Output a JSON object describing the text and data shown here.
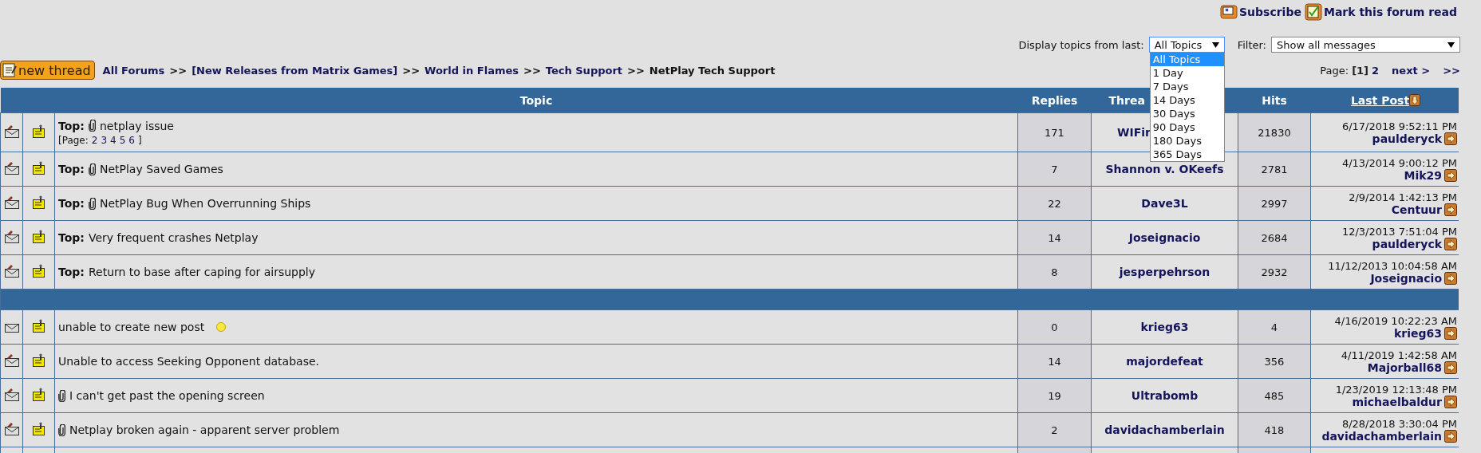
{
  "header_links": [
    {
      "label": "Subscribe",
      "kind": "subscribe"
    },
    {
      "label": "Mark this forum read",
      "kind": "mark_read"
    }
  ],
  "display_filter": {
    "label": "Display topics from last:",
    "value": "All Topics",
    "expanded": true,
    "options": [
      {
        "label": "All Topics",
        "selected": true
      },
      {
        "label": "1 Day",
        "selected": false
      },
      {
        "label": "7 Days",
        "selected": false
      },
      {
        "label": "14 Days",
        "selected": false
      },
      {
        "label": "30 Days",
        "selected": false
      },
      {
        "label": "90 Days",
        "selected": false
      },
      {
        "label": "180 Days",
        "selected": false
      },
      {
        "label": "365 Days",
        "selected": false
      }
    ]
  },
  "message_filter": {
    "label": "Filter:",
    "value": "Show all messages"
  },
  "new_thread_button": {
    "label": "new thread"
  },
  "breadcrumb": [
    {
      "label": "All Forums",
      "kind": "link"
    },
    {
      "label": ">>",
      "kind": "separator"
    },
    {
      "label": "[New Releases from Matrix Games]",
      "kind": "link"
    },
    {
      "label": ">>",
      "kind": "separator"
    },
    {
      "label": "World in Flames",
      "kind": "link"
    },
    {
      "label": ">>",
      "kind": "separator"
    },
    {
      "label": "Tech Support",
      "kind": "link"
    },
    {
      "label": ">>",
      "kind": "separator"
    },
    {
      "label": "NetPlay Tech Support",
      "kind": "current"
    }
  ],
  "pagination": {
    "label": "Page:",
    "pages": [
      {
        "label": "[1]",
        "selected": true
      },
      {
        "label": "2",
        "selected": false
      }
    ],
    "next": "next >",
    "last": ">>"
  },
  "table": {
    "columns": [
      {
        "label": "Topic",
        "sorted": false
      },
      {
        "label": "Replies",
        "sorted": false
      },
      {
        "label": "Threa",
        "sorted": false
      },
      {
        "label": "Hits",
        "sorted": false
      },
      {
        "label": "Last Post",
        "sorted": true
      }
    ],
    "sections": [
      {
        "rows": [
          {
            "prefix": "Top:",
            "attachment": true,
            "title": "netplay issue",
            "replied": true,
            "new": false,
            "page_links": {
              "label": "[Page:",
              "pages": [
                "2",
                "3",
                "4",
                "5",
                "6"
              ],
              "end": "]"
            },
            "replies": "171",
            "starter": "WIFir",
            "hits": "21830",
            "last_date": "6/17/2018 9:52:11 PM",
            "last_user": "paulderyck"
          },
          {
            "prefix": "Top:",
            "attachment": true,
            "title": "NetPlay Saved Games",
            "replied": true,
            "new": false,
            "replies": "7",
            "starter": "Shannon v. OKeefs",
            "hits": "2781",
            "last_date": "4/13/2014 9:00:12 PM",
            "last_user": "Mik29"
          },
          {
            "prefix": "Top:",
            "attachment": true,
            "title": "NetPlay Bug When Overrunning Ships",
            "replied": true,
            "new": false,
            "replies": "22",
            "starter": "Dave3L",
            "hits": "2997",
            "last_date": "2/9/2014 1:42:13 PM",
            "last_user": "Centuur"
          },
          {
            "prefix": "Top:",
            "attachment": false,
            "title": "Very frequent crashes Netplay",
            "replied": true,
            "new": false,
            "replies": "14",
            "starter": "Joseignacio",
            "hits": "2684",
            "last_date": "12/3/2013 7:51:04 PM",
            "last_user": "paulderyck"
          },
          {
            "prefix": "Top:",
            "attachment": false,
            "title": "Return to base after caping for airsupply",
            "replied": true,
            "new": false,
            "replies": "8",
            "starter": "jesperpehrson",
            "hits": "2932",
            "last_date": "11/12/2013 10:04:58 AM",
            "last_user": "Joseignacio"
          }
        ]
      },
      {
        "rows": [
          {
            "attachment": false,
            "title": "unable to create new post",
            "replied": false,
            "new": true,
            "replies": "0",
            "starter": "krieg63",
            "hits": "4",
            "last_date": "4/16/2019 10:22:23 AM",
            "last_user": "krieg63"
          },
          {
            "attachment": false,
            "title": "Unable to access Seeking Opponent database.",
            "replied": true,
            "new": false,
            "replies": "14",
            "starter": "majordefeat",
            "hits": "356",
            "last_date": "4/11/2019 1:42:58 AM",
            "last_user": "Majorball68"
          },
          {
            "attachment": true,
            "title": "I can't get past the opening screen",
            "replied": true,
            "new": false,
            "replies": "19",
            "starter": "Ultrabomb",
            "hits": "485",
            "last_date": "1/23/2019 12:13:48 PM",
            "last_user": "michaelbaldur"
          },
          {
            "attachment": true,
            "title": "Netplay broken again - apparent server problem",
            "replied": true,
            "new": false,
            "replies": "2",
            "starter": "davidachamberlain",
            "hits": "418",
            "last_date": "8/28/2018 3:30:04 PM",
            "last_user": "davidachamberlain"
          }
        ]
      }
    ]
  }
}
